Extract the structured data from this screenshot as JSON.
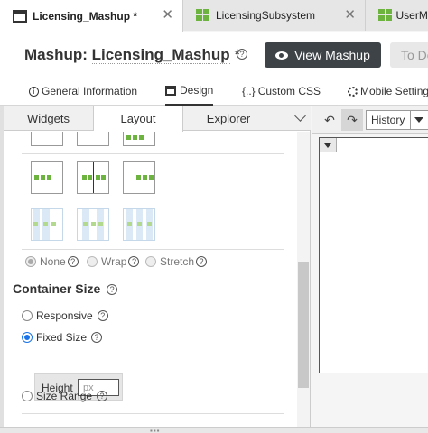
{
  "tabs": [
    {
      "label": "Licensing_Mashup *",
      "active": true,
      "icon": "mashup-icon"
    },
    {
      "label": "LicensingSubsystem",
      "active": false,
      "icon": "subsystem-icon"
    },
    {
      "label": "UserMa",
      "active": false,
      "icon": "subsystem-icon"
    }
  ],
  "header": {
    "prefix": "Mashup: ",
    "name": "Licensing_Mashup",
    "modified_marker": " *",
    "help": "?",
    "view_button": "View Mashup",
    "todesign_button": "To De"
  },
  "subtabs": [
    {
      "label": "General Information",
      "icon": "info-icon"
    },
    {
      "label": "Design",
      "icon": "design-icon",
      "active": true
    },
    {
      "label": "Custom CSS",
      "icon": "custom-css-icon",
      "prefix": "{..}"
    },
    {
      "label": "Mobile Setting",
      "icon": "gear-icon"
    }
  ],
  "panel_tabs": [
    "Widgets",
    "Layout",
    "Explorer"
  ],
  "active_panel_tab": "Layout",
  "spacing": {
    "none": "None",
    "wrap": "Wrap",
    "stretch": "Stretch",
    "selected": "None",
    "help": "?"
  },
  "container_size": {
    "title": "Container Size",
    "help": "?",
    "responsive": "Responsive",
    "fixed": "Fixed Size",
    "range": "Size Range",
    "selected": "Fixed Size",
    "height_label": "Height",
    "height_placeholder": "px",
    "height_value": ""
  },
  "right": {
    "history_label": "History"
  },
  "colors": {
    "accent_green": "#6db33f",
    "view_button_bg": "#3d4346",
    "radio_checked": "#1a73e8"
  }
}
